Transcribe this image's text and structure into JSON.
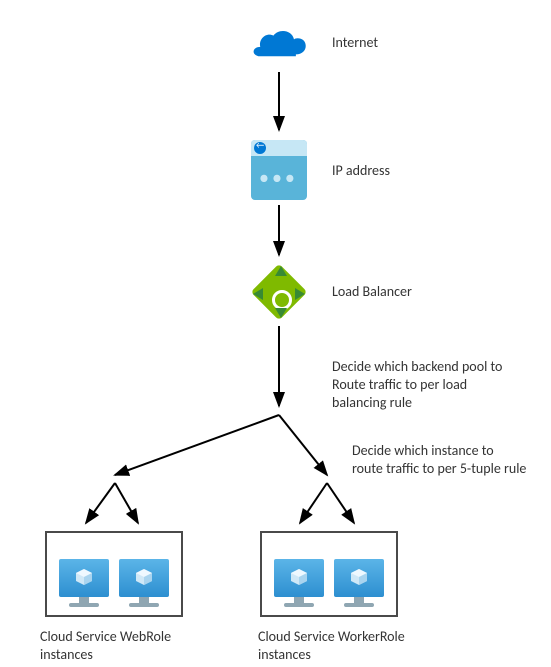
{
  "nodes": {
    "internet": {
      "label": "Internet"
    },
    "ip": {
      "label": "IP address"
    },
    "lb": {
      "label": "Load Balancer"
    },
    "webrole": {
      "label": "Cloud Service WebRole instances"
    },
    "workerrole": {
      "label": "Cloud Service WorkerRole instances"
    }
  },
  "annotations": {
    "backend_pool": "Decide which backend pool to Route traffic to per load balancing rule",
    "five_tuple": "Decide which instance to route traffic to per 5-tuple rule"
  },
  "colors": {
    "azure_blue": "#0078d4",
    "lb_green": "#7fba00"
  }
}
